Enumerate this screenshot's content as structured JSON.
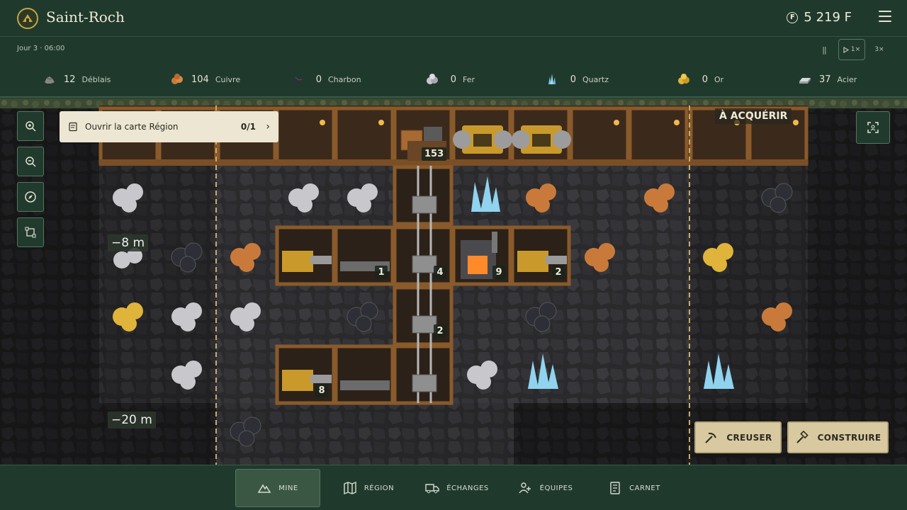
{
  "header": {
    "title": "Saint-Roch",
    "money": "5 219 F",
    "currency_symbol": "F"
  },
  "time": {
    "clock": "Jour 3 · 06:00",
    "pause_label": "||",
    "play_label": "1×",
    "fast_label": "3×"
  },
  "resources": [
    {
      "name": "Déblais",
      "count": "12",
      "icon": "rubble-icon",
      "color": "#8a8580"
    },
    {
      "name": "Cuivre",
      "count": "104",
      "icon": "copper-ore-icon",
      "color": "#c97a3a"
    },
    {
      "name": "Charbon",
      "count": "0",
      "icon": "coal-icon",
      "color": "#2e2f36"
    },
    {
      "name": "Fer",
      "count": "0",
      "icon": "iron-ore-icon",
      "color": "#c8c8cc"
    },
    {
      "name": "Quartz",
      "count": "0",
      "icon": "quartz-icon",
      "color": "#8fd3ef"
    },
    {
      "name": "Or",
      "count": "0",
      "icon": "gold-ore-icon",
      "color": "#e0b43a"
    },
    {
      "name": "Acier",
      "count": "37",
      "icon": "steel-ingot-icon",
      "color": "#b9bcc0"
    }
  ],
  "quest": {
    "label": "Ouvrir la carte Région",
    "progress": "0/1"
  },
  "map": {
    "acquire_label": "À ACQUÉRIR",
    "depth_top": "−8 m",
    "depth_bottom": "−20 m",
    "badges": {
      "elevator_top": "153",
      "conveyor_1": "1",
      "shaft_mid": "4",
      "furnace": "9",
      "drill_right": "2",
      "shaft_low": "2",
      "drill_low": "8"
    }
  },
  "actions": {
    "dig": "CREUSER",
    "build": "CONSTRUIRE"
  },
  "nav": [
    {
      "label": "MINE",
      "icon": "mountain-icon",
      "active": true
    },
    {
      "label": "RÉGION",
      "icon": "map-icon",
      "active": false
    },
    {
      "label": "ÉCHANGES",
      "icon": "truck-icon",
      "active": false
    },
    {
      "label": "ÉQUIPES",
      "icon": "team-icon",
      "active": false
    },
    {
      "label": "CARNET",
      "icon": "notebook-icon",
      "active": false
    }
  ]
}
